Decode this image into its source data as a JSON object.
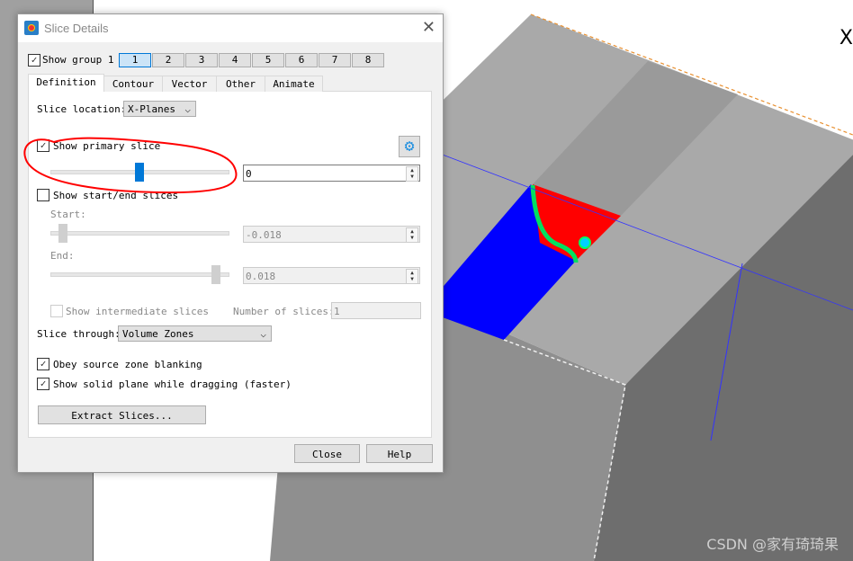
{
  "window": {
    "title": "Slice Details"
  },
  "show_group": {
    "label": "Show group 1",
    "checked": true,
    "groups": [
      "1",
      "2",
      "3",
      "4",
      "5",
      "6",
      "7",
      "8"
    ],
    "selected": "1"
  },
  "tabs": [
    "Definition",
    "Contour",
    "Vector",
    "Other",
    "Animate"
  ],
  "active_tab": "Definition",
  "definition": {
    "slice_location_label": "Slice location:",
    "slice_location_value": "X-Planes",
    "show_primary_label": "Show primary slice",
    "show_primary_checked": true,
    "primary_value": "0",
    "primary_slider_fraction": 0.5,
    "show_start_end_label": "Show start/end slices",
    "show_start_end_checked": false,
    "start_label": "Start:",
    "start_value": "-0.018",
    "end_label": "End:",
    "end_value": "0.018",
    "show_intermediate_label": "Show intermediate slices",
    "num_slices_label": "Number of slices:",
    "num_slices_value": "1",
    "slice_through_label": "Slice through:",
    "slice_through_value": "Volume Zones",
    "obey_blanking_label": "Obey source zone blanking",
    "obey_blanking_checked": true,
    "solid_plane_label": "Show solid plane while dragging (faster)",
    "solid_plane_checked": true,
    "extract_label": "Extract Slices..."
  },
  "footer": {
    "close_label": "Close",
    "help_label": "Help"
  },
  "viewport": {
    "axis_label": "X",
    "watermark": "CSDN @家有琦琦果"
  },
  "colors": {
    "highlight_annotation": "#ff0000",
    "accent": "#0078d7"
  }
}
